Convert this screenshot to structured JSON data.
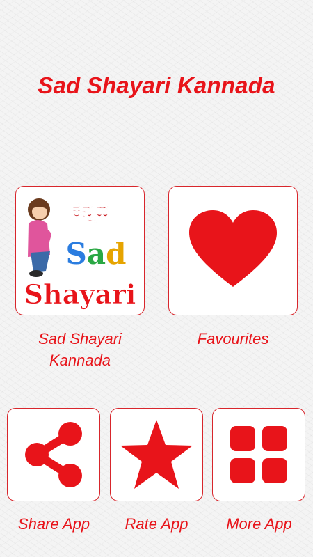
{
  "header": {
    "title": "Sad Shayari Kannada"
  },
  "main_tiles": [
    {
      "label": "Sad Shayari Kannada",
      "icon": "sad-shayari-logo-icon"
    },
    {
      "label": "Favourites",
      "icon": "heart-icon"
    }
  ],
  "logo": {
    "line1": "ಕನ್ನಡ",
    "line2": "Sad",
    "line3": "Shayari"
  },
  "actions": [
    {
      "label": "Share App",
      "icon": "share-icon"
    },
    {
      "label": "Rate App",
      "icon": "star-icon"
    },
    {
      "label": "More App",
      "icon": "grid-icon"
    }
  ],
  "colors": {
    "accent": "#e8141a",
    "border": "#d8262c",
    "background": "#f4f4f4"
  }
}
